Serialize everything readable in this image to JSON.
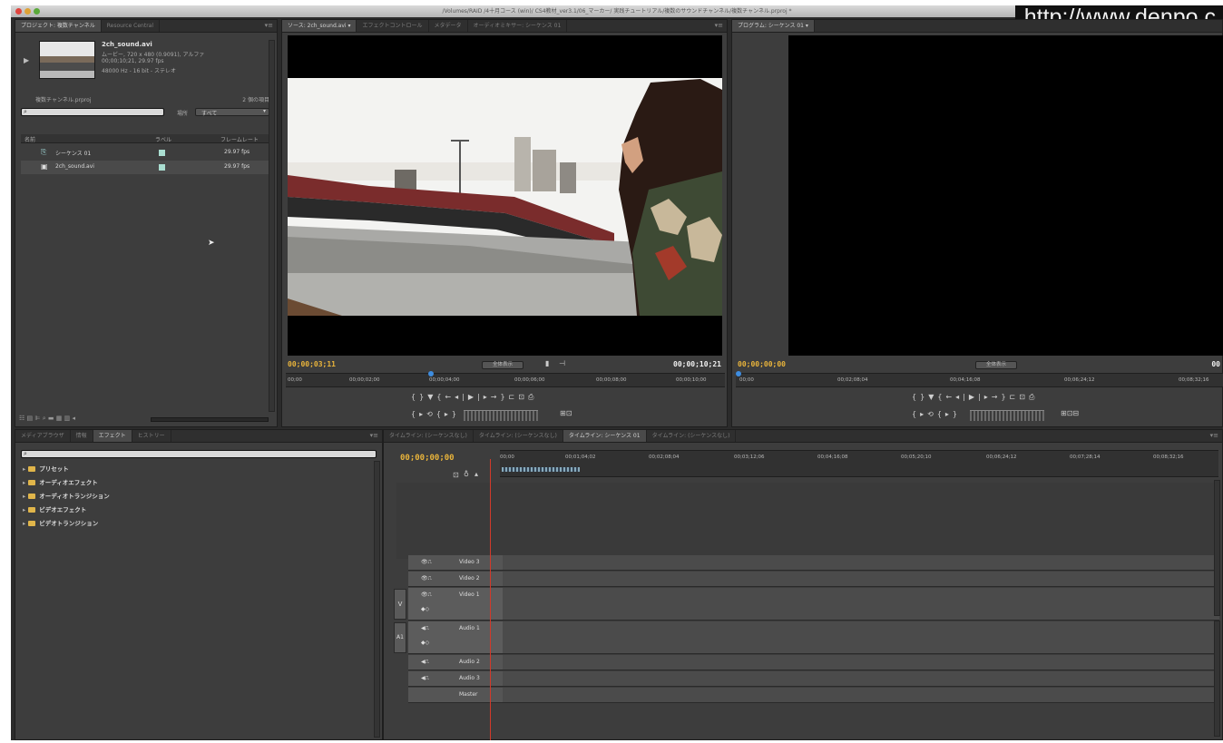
{
  "window": {
    "title": "/Volumes/RAID /4十月コース (win)/ CS4教材_ver3.1/06_マーカー/ 実践チュートリアル/複数のサウンドチャンネル/複数チャンネル.prproj *",
    "watermark": "http://www.denpo.c"
  },
  "project_panel": {
    "tabs": [
      "プロジェクト: 複数チャンネル",
      "Resource Central"
    ],
    "clip": {
      "name": "2ch_sound.avi",
      "info": [
        "ムービー, 720 x 480 (0.9091), アルファ",
        "00;00;10;21, 29.97 fps",
        "48000 Hz - 16 bit - ステレオ"
      ]
    },
    "project_file": "複数チャンネル.prproj",
    "item_count": "2 個の項目",
    "in_label": "場所",
    "in_value": "すべて",
    "columns": [
      "名前",
      "ラベル",
      "フレームレート"
    ],
    "items": [
      {
        "name": "シーケンス 01",
        "rate": "29.97 fps"
      },
      {
        "name": "2ch_sound.avi",
        "rate": "29.97 fps"
      }
    ]
  },
  "source_monitor": {
    "tabs": [
      "ソース: 2ch_sound.avi",
      "エフェクトコントロール",
      "メタデータ",
      "オーディオミキサー: シーケンス 01"
    ],
    "timecode_current": "00;00;03;11",
    "timecode_duration": "00;00;10;21",
    "zoom": "全体表示",
    "ruler": [
      "00;00",
      "00;00;02;00",
      "00;00;04;00",
      "00;00;06;00",
      "00;00;08;00",
      "00;00;10;00"
    ],
    "playhead_fraction": 0.33
  },
  "program_monitor": {
    "tabs": [
      "プログラム: シーケンス 01"
    ],
    "timecode_current": "00;00;00;00",
    "timecode_duration": "00",
    "zoom": "全体表示",
    "ruler": [
      "00;00",
      "00;02;08;04",
      "00;04;16;08",
      "00;06;24;12",
      "00;08;32;16"
    ]
  },
  "effects_panel": {
    "tabs": [
      "メディアブラウザ",
      "情報",
      "エフェクト",
      "ヒストリー"
    ],
    "items": [
      "プリセット",
      "オーディオエフェクト",
      "オーディオトランジション",
      "ビデオエフェクト",
      "ビデオトランジション"
    ]
  },
  "timeline": {
    "tabs": [
      "タイムライン: (シーケンスなし)",
      "タイムライン: (シーケンスなし)",
      "タイムライン: シーケンス 01",
      "タイムライン: (シーケンスなし)"
    ],
    "timecode": "00;00;00;00",
    "ruler": [
      "00;00",
      "00;01;04;02",
      "00;02;08;04",
      "00;03;12;06",
      "00;04;16;08",
      "00;05;20;10",
      "00;06;24;12",
      "00;07;28;14",
      "00;08;32;16"
    ],
    "video_target": "V",
    "audio_target": "A1",
    "tracks": [
      "Video 3",
      "Video 2",
      "Video 1",
      "Audio 1",
      "Audio 2",
      "Audio 3",
      "Master"
    ]
  }
}
